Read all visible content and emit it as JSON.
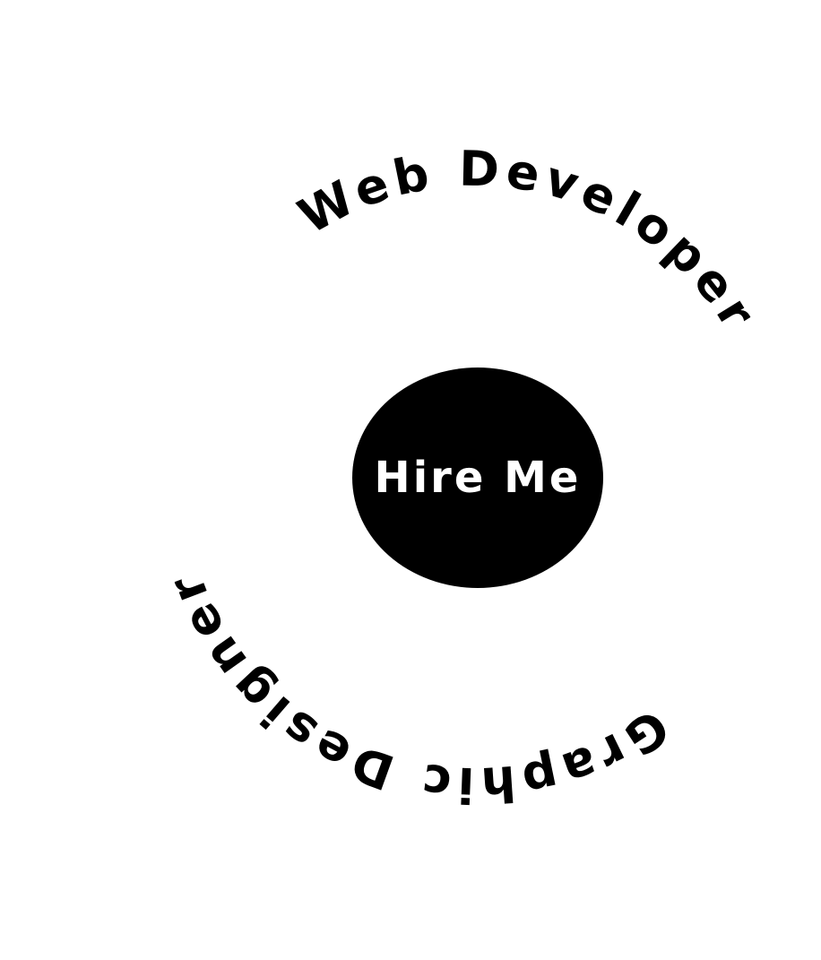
{
  "ring": {
    "top_text": "Web  Developer",
    "bottom_text": "Graphic  Designer"
  },
  "cta": {
    "label": "Hire Me"
  },
  "colors": {
    "background": "#ffffff",
    "ink": "#000000",
    "button_fill": "#000000",
    "button_text": "#ffffff"
  }
}
